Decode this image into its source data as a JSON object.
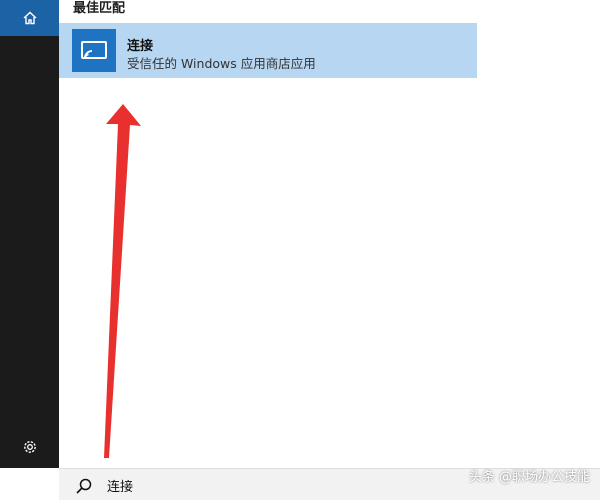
{
  "search_results": {
    "section_header": "最佳匹配",
    "best_match": {
      "name": "连接",
      "description": "受信任的 Windows 应用商店应用",
      "icon": "connect-icon"
    }
  },
  "sidebar": {
    "home_icon": "home-icon",
    "settings_icon": "gear-icon"
  },
  "search_box": {
    "icon": "search-icon",
    "query": "连接"
  },
  "watermark": "头条 @职场办公技能",
  "colors": {
    "sidebar_bg": "#1b1b1b",
    "home_active": "#1c63a6",
    "selected_result": "#b7d6f2",
    "app_tile": "#1e73c3",
    "annotation_arrow": "#e8302e"
  }
}
